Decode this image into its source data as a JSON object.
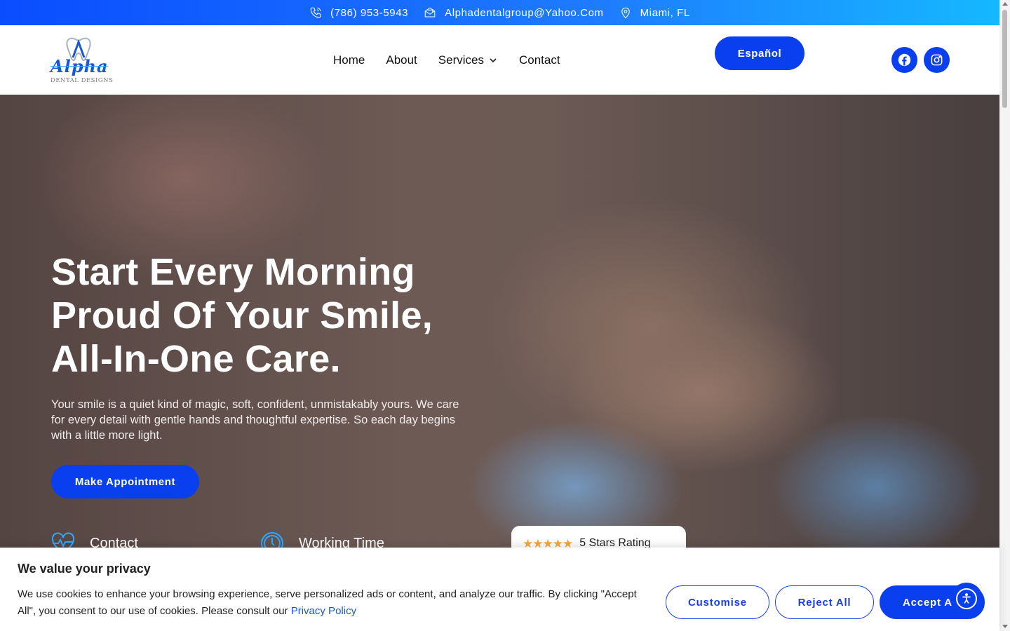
{
  "topbar": {
    "phone": "(786) 953-5943",
    "email": "Alphadentalgroup@Yahoo.Com",
    "location": "Miami, FL"
  },
  "logo": {
    "name": "Alpha",
    "subtitle": "DENTAL DESIGNS"
  },
  "nav": {
    "home": "Home",
    "about": "About",
    "services": "Services",
    "contact": "Contact"
  },
  "header": {
    "language_button": "Español",
    "social": [
      "facebook-icon",
      "instagram-icon"
    ]
  },
  "hero": {
    "title": "Start Every Morning Proud Of Your Smile, All-In-One Care.",
    "description": "Your smile is a quiet kind of magic, soft, confident, unmistakably yours. We care for every detail with gentle hands and thoughtful expertise. So each day begins with a little more light.",
    "cta": "Make Appointment",
    "contact_label": "Contact",
    "working_time_label": "Working Time",
    "rating_stars": "★★★★★",
    "rating_label": "5 Stars Rating"
  },
  "cookie": {
    "title": "We value your privacy",
    "text": "We use cookies to enhance your browsing experience, serve personalized ads or content, and analyze our traffic. By clicking \"Accept All\", you consent to our use of cookies. Please consult our",
    "link": "Privacy Policy",
    "customise": "Customise",
    "reject": "Reject All",
    "accept": "Accept All"
  },
  "colors": {
    "brand": "#0a3ff0",
    "accent": "#15b8ff",
    "stars": "#f2a93b"
  }
}
